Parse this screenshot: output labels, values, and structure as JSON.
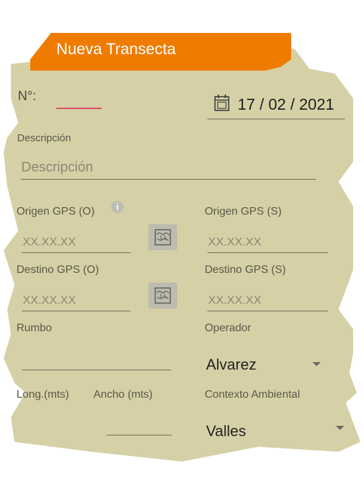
{
  "header": {
    "title": "Nueva Transecta"
  },
  "number": {
    "label": "N°:",
    "value": ""
  },
  "date": {
    "value": "17 / 02 / 2021"
  },
  "description": {
    "label": "Descripción",
    "placeholder": "Descripción"
  },
  "gps": {
    "origin_o_label": "Origen GPS (O)",
    "origin_o_placeholder": "XX.XX.XX",
    "origin_s_label": "Origen GPS (S)",
    "origin_s_placeholder": "XX.XX.XX",
    "dest_o_label": "Destino GPS (O)",
    "dest_o_placeholder": "XX.XX.XX",
    "dest_s_label": "Destino GPS (S)",
    "dest_s_placeholder": "XX.XX.XX"
  },
  "rumbo": {
    "label": "Rumbo",
    "value": ""
  },
  "operador": {
    "label": "Operador",
    "selected": "Alvarez"
  },
  "dimensions": {
    "length_label": "Long.(mts)",
    "width_label": "Ancho (mts)"
  },
  "contexto": {
    "label": "Contexto Ambiental",
    "selected": "Valles"
  },
  "colors": {
    "header": "#ef7c00",
    "background": "#d6d0a6",
    "accent": "#e0476b"
  }
}
